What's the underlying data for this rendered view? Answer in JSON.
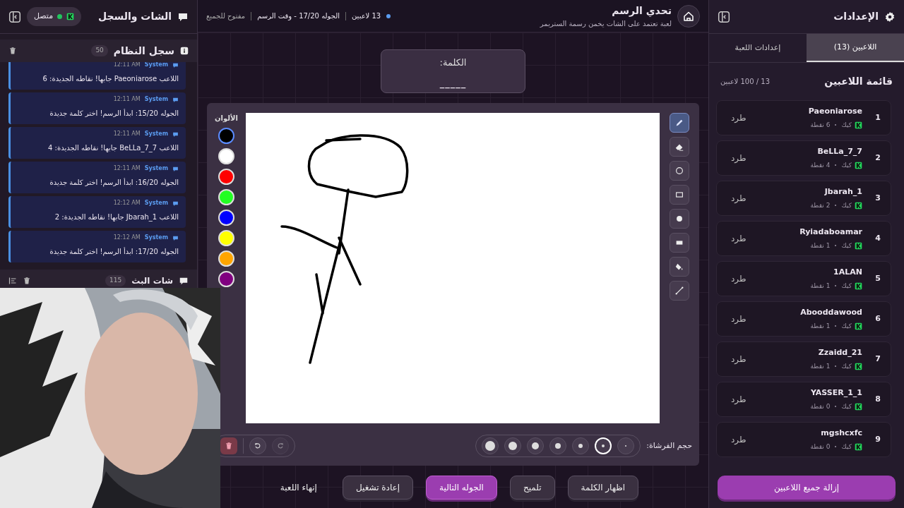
{
  "chat_panel": {
    "title": "الشات والسجل",
    "status": {
      "label": "متصل",
      "connected": true
    },
    "system_log": {
      "title": "سجل النظام",
      "count": "50",
      "messages": [
        {
          "sender": "System",
          "time": "12:11 AM",
          "text": "اللاعب Paeoniarose جابها! نقاطه الجديدة: 6"
        },
        {
          "sender": "System",
          "time": "12:11 AM",
          "text": "الجوله 15/20: ابدأ الرسم! اختر كلمة جديدة"
        },
        {
          "sender": "System",
          "time": "12:11 AM",
          "text": "اللاعب BeLLa_7_7 جابها! نقاطه الجديدة: 4"
        },
        {
          "sender": "System",
          "time": "12:11 AM",
          "text": "الجوله 16/20: ابدأ الرسم! اختر كلمة جديدة"
        },
        {
          "sender": "System",
          "time": "12:12 AM",
          "text": "اللاعب Jbarah_1 جابها! نقاطه الجديدة: 2"
        },
        {
          "sender": "System",
          "time": "12:12 AM",
          "text": "الجوله 17/20: ابدأ الرسم! اختر كلمة جديدة"
        }
      ]
    },
    "stream_chat": {
      "title": "شات البث",
      "count": "115"
    }
  },
  "game": {
    "title": "تحدي الرسم",
    "subtitle": "لعبة تعتمد على الشات يخمن رسمة الستريمر",
    "players": "13 لاعبين",
    "round": "الجوله 17/20 - وقت الرسم",
    "access": "مفتوح للجميع",
    "word": {
      "label": "الكلمة:",
      "value": "_____"
    },
    "colors_title": "الألوان",
    "colors": [
      {
        "color": "#000000",
        "selected": true
      },
      {
        "color": "#ffffff",
        "selected": false
      },
      {
        "color": "#ff0000",
        "selected": false
      },
      {
        "color": "#22ff22",
        "selected": false
      },
      {
        "color": "#0000ff",
        "selected": false
      },
      {
        "color": "#ffff00",
        "selected": false
      },
      {
        "color": "#ffa500",
        "selected": false
      },
      {
        "color": "#800080",
        "selected": false
      }
    ],
    "tools": [
      {
        "kind": "pen",
        "selected": true
      },
      {
        "kind": "eraser",
        "selected": false
      },
      {
        "kind": "circle",
        "selected": false
      },
      {
        "kind": "rect",
        "selected": false
      },
      {
        "kind": "filled-circle",
        "selected": false
      },
      {
        "kind": "filled-rect",
        "selected": false
      },
      {
        "kind": "fill",
        "selected": false
      },
      {
        "kind": "line",
        "selected": false
      }
    ],
    "brush_label": "حجم الفرشاة:",
    "brush_sizes": [
      {
        "selected": false
      },
      {
        "selected": true
      },
      {
        "selected": false
      },
      {
        "selected": false
      },
      {
        "selected": false
      },
      {
        "selected": false
      },
      {
        "selected": false
      }
    ],
    "history": [
      {
        "kind": "redo",
        "disabled": true
      },
      {
        "kind": "undo",
        "disabled": false
      }
    ],
    "actions": [
      {
        "label": "اظهار الكلمة",
        "kind": "secondary"
      },
      {
        "label": "تلميح",
        "kind": "secondary"
      },
      {
        "label": "الجوله التالية",
        "kind": "primary"
      },
      {
        "label": "إعادة تشغيل",
        "kind": "secondary"
      },
      {
        "label": "إنهاء اللعبة",
        "kind": "plain"
      }
    ]
  },
  "settings_panel": {
    "title": "الإعدادات",
    "tabs": [
      {
        "label": "اللاعبين (13)",
        "selected": true
      },
      {
        "label": "إعدادات اللعبة",
        "selected": false
      }
    ],
    "list_title": "قائمة اللاعبين",
    "list_count": "13 / 100 لاعبين",
    "players": [
      {
        "rank": "1",
        "name": "Paeoniarose",
        "platform": "كيك",
        "points": "6 نقطة",
        "kick": "طرد"
      },
      {
        "rank": "2",
        "name": "BeLLa_7_7",
        "platform": "كيك",
        "points": "4 نقطة",
        "kick": "طرد"
      },
      {
        "rank": "3",
        "name": "Jbarah_1",
        "platform": "كيك",
        "points": "2 نقطة",
        "kick": "طرد"
      },
      {
        "rank": "4",
        "name": "Ryiadaboamar",
        "platform": "كيك",
        "points": "1 نقطة",
        "kick": "طرد"
      },
      {
        "rank": "5",
        "name": "1ALAN",
        "platform": "كيك",
        "points": "1 نقطة",
        "kick": "طرد"
      },
      {
        "rank": "6",
        "name": "Abooddawood",
        "platform": "كيك",
        "points": "1 نقطة",
        "kick": "طرد"
      },
      {
        "rank": "7",
        "name": "Zzaidd_21",
        "platform": "كيك",
        "points": "1 نقطة",
        "kick": "طرد"
      },
      {
        "rank": "8",
        "name": "YASSER_1_1",
        "platform": "كيك",
        "points": "0 نقطة",
        "kick": "طرد"
      },
      {
        "rank": "9",
        "name": "mgshcxfc",
        "platform": "كيك",
        "points": "0 نقطة",
        "kick": "طرد"
      }
    ],
    "remove_all": "إزالة جميع اللاعبين"
  }
}
